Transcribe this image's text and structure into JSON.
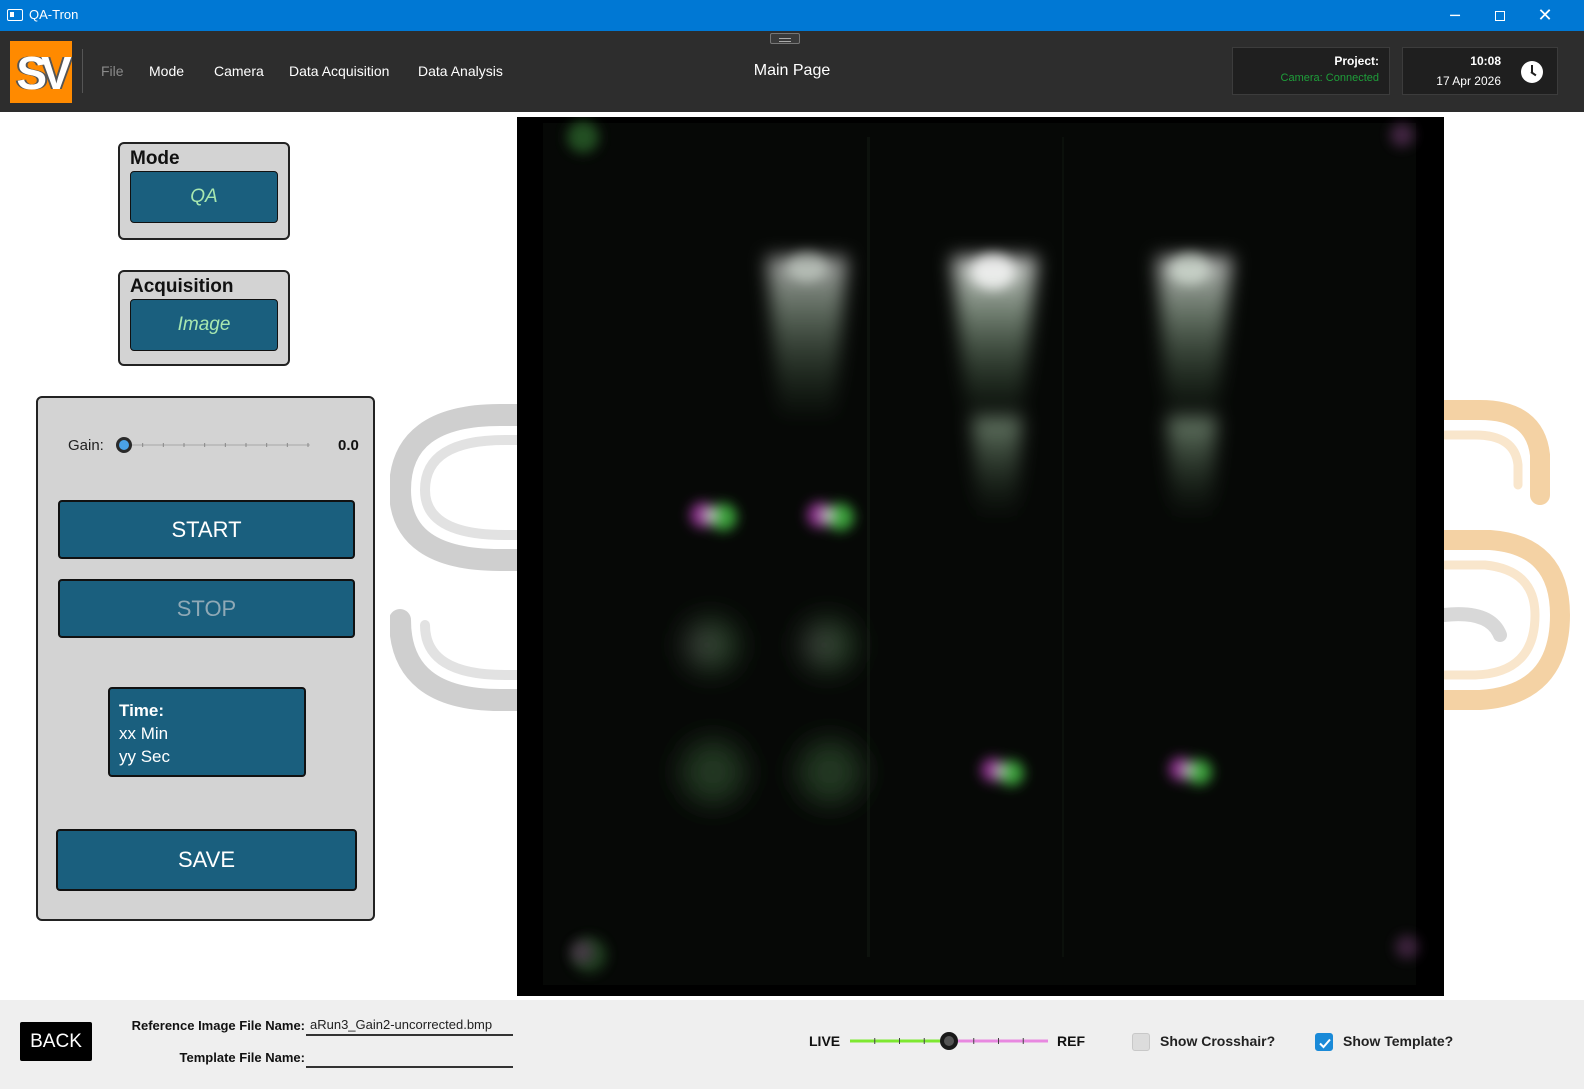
{
  "window": {
    "title": "QA-Tron"
  },
  "menu": {
    "logo_text": "SV",
    "items": [
      {
        "label": "File",
        "enabled": false
      },
      {
        "label": "Mode",
        "enabled": true
      },
      {
        "label": "Camera",
        "enabled": true
      },
      {
        "label": "Data Acquisition",
        "enabled": true
      },
      {
        "label": "Data Analysis",
        "enabled": true
      }
    ],
    "page_title": "Main Page",
    "project": {
      "label": "Project:",
      "camera_status": "Camera: Connected",
      "status_color": "#1f9e3a"
    },
    "clock": {
      "time": "10:08",
      "date": "17 Apr 2026"
    }
  },
  "left_panel": {
    "mode": {
      "title": "Mode",
      "value": "QA"
    },
    "acquisition": {
      "title": "Acquisition",
      "value": "Image"
    },
    "gain": {
      "label": "Gain:",
      "value": "0.0",
      "level": 0.0
    },
    "start_label": "START",
    "stop_label": "STOP",
    "time": {
      "label": "Time:",
      "minutes": "xx Min",
      "seconds": "yy Sec"
    },
    "save_label": "SAVE"
  },
  "bottom": {
    "back_label": "BACK",
    "reference_label": "Reference Image File Name:",
    "reference_value": "aRun3_Gain2-uncorrected.bmp",
    "template_label": "Template File Name:",
    "template_value": "",
    "live_label": "LIVE",
    "ref_label": "REF",
    "blend_level": 0.5,
    "crosshair_label": "Show Crosshair?",
    "crosshair_checked": false,
    "template_checkbox_label": "Show Template?",
    "template_checked": true
  },
  "colors": {
    "titlebar": "#0078d4",
    "menubar": "#2d2d2d",
    "button": "#1a5f7e",
    "accent_text": "#a8e8b0",
    "live_green": "#7ee830",
    "ref_pink": "#e888e0"
  },
  "icons": [
    "app-icon",
    "minimize-icon",
    "maximize-icon",
    "close-icon",
    "clock-icon",
    "checkmark-icon"
  ]
}
